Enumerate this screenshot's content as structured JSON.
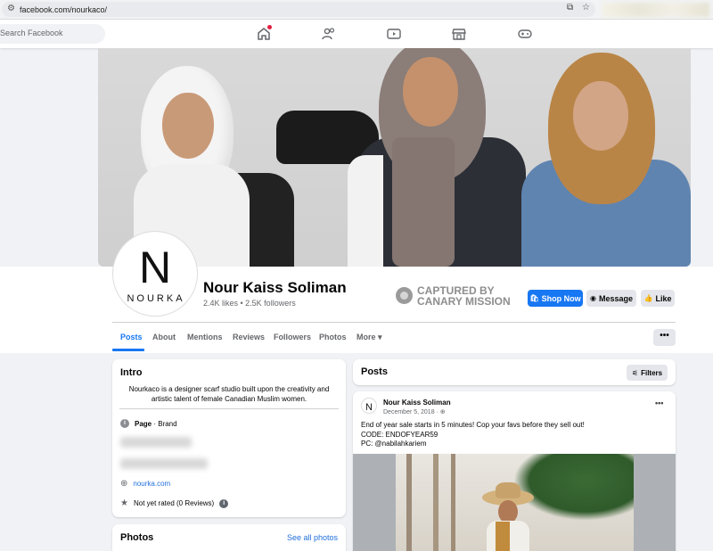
{
  "browser": {
    "url": "facebook.com/nourkaco/"
  },
  "topnav": {
    "search_placeholder": "Search Facebook",
    "icons": [
      "home-icon",
      "friends-icon",
      "video-icon",
      "marketplace-icon",
      "gaming-icon"
    ]
  },
  "profile": {
    "logo_letter": "N",
    "logo_word": "NOURKA",
    "name": "Nour Kaiss Soliman",
    "stats": "2.4K likes • 2.5K followers"
  },
  "watermark": {
    "line1": "CAPTURED BY",
    "line2": "CANARY MISSION"
  },
  "actions": {
    "shop": "Shop Now",
    "message": "Message",
    "like": "Like"
  },
  "tabs": {
    "posts": "Posts",
    "about": "About",
    "mentions": "Mentions",
    "reviews": "Reviews",
    "followers": "Followers",
    "photos": "Photos",
    "more": "More",
    "more_button": "•••"
  },
  "intro": {
    "title": "Intro",
    "bio": "Nourkaco is a designer scarf studio built upon the creativity and artistic talent of female Canadian Muslim women.",
    "page_type_bold": "Page",
    "page_type_rest": " · Brand",
    "website": "nourka.com",
    "rating": "Not yet rated (0 Reviews)"
  },
  "photos": {
    "title": "Photos",
    "see_all": "See all photos"
  },
  "posts": {
    "title": "Posts",
    "filters": "Filters",
    "item": {
      "author": "Nour Kaiss Soliman",
      "date": "December 5, 2018 · ",
      "text_line1": "End of year sale starts in 5 minutes! Cop your favs before they sell out!",
      "text_line2": "CODE: ENDOFYEAR59",
      "text_line3": "PC: @nabilahkariem"
    }
  },
  "colors": {
    "accent": "#1877f2",
    "background": "#f0f2f5",
    "secondary_button": "#e4e6eb"
  }
}
